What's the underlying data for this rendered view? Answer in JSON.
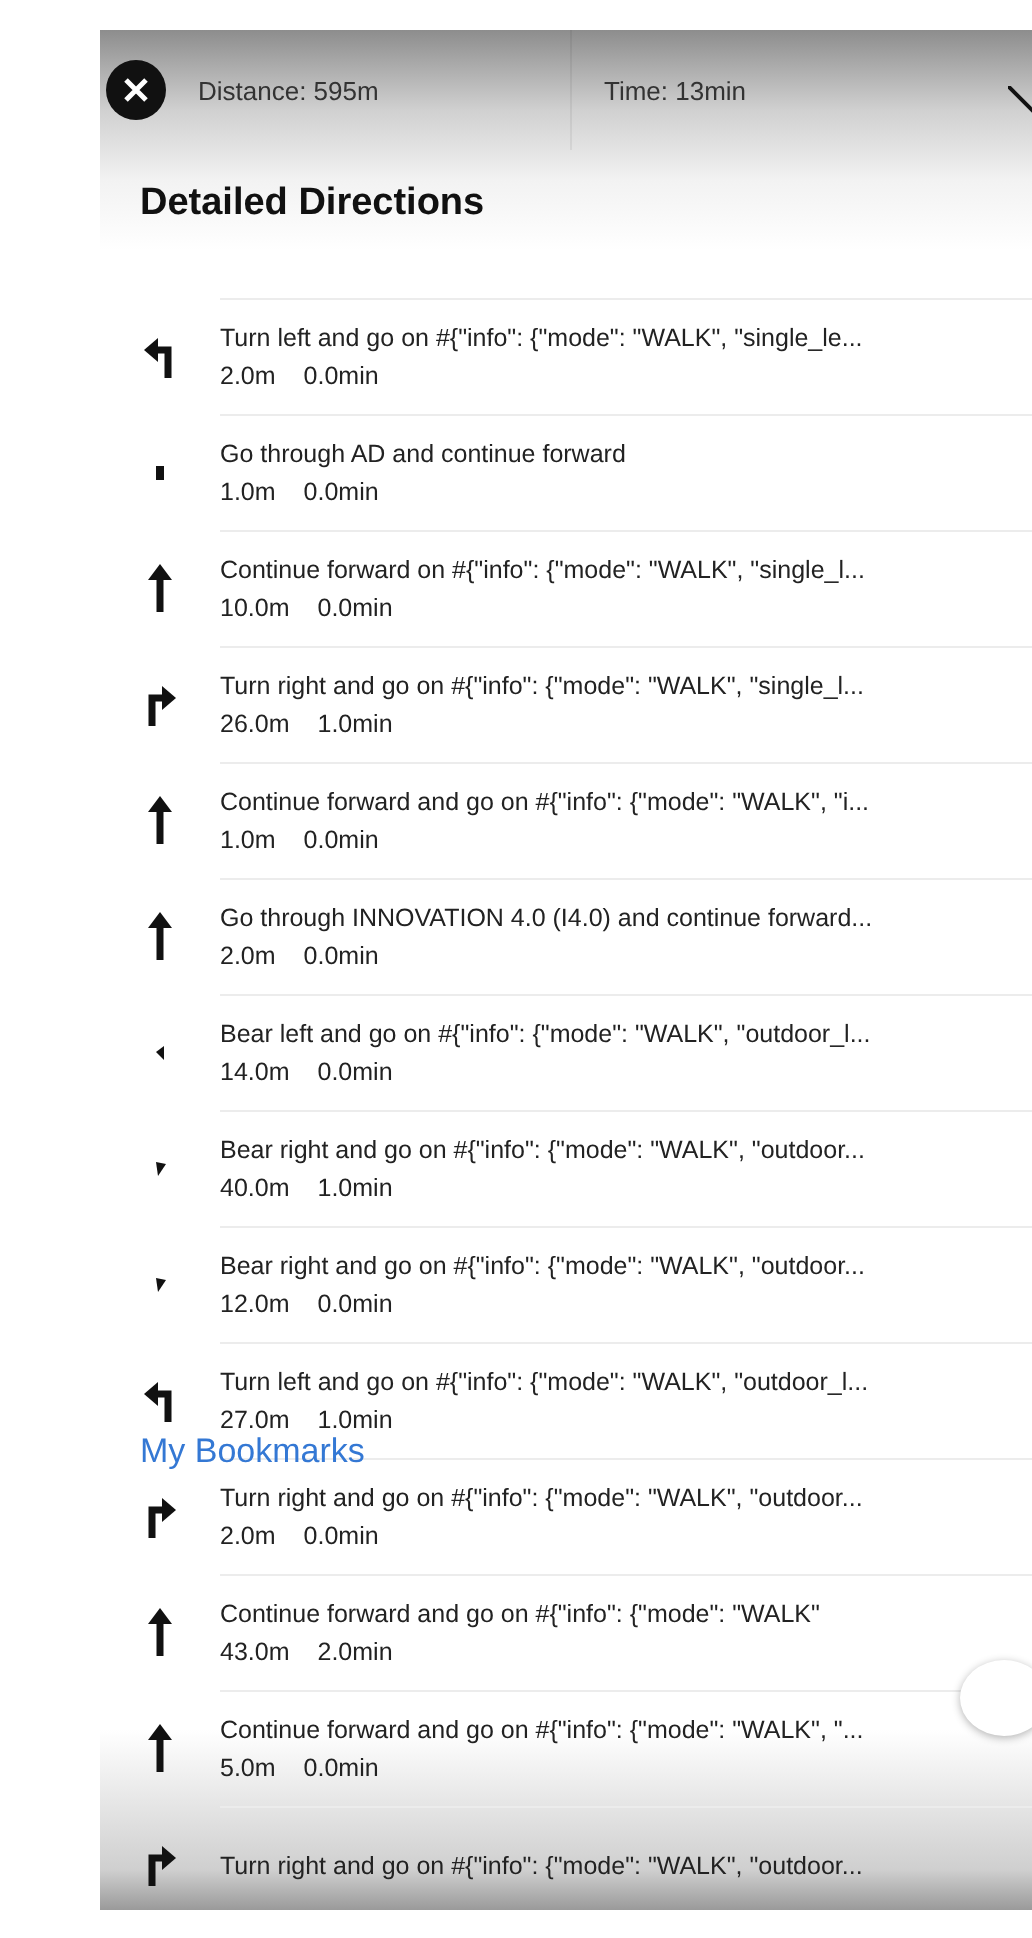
{
  "header": {
    "distance": "Distance: 595m",
    "time": "Time: 13min"
  },
  "title": "Detailed Directions",
  "steps": [
    {
      "kind": "turn-left",
      "text": "Turn left and go on #{\"info\": {\"mode\": \"WALK\", \"single_le...",
      "distance": "2.0m",
      "duration": "0.0min"
    },
    {
      "kind": "dot",
      "text": "Go through AD and continue forward",
      "distance": "1.0m",
      "duration": "0.0min"
    },
    {
      "kind": "straight",
      "text": "Continue forward on #{\"info\": {\"mode\": \"WALK\", \"single_l...",
      "distance": "10.0m",
      "duration": "0.0min"
    },
    {
      "kind": "turn-right",
      "text": "Turn right and go on #{\"info\": {\"mode\": \"WALK\", \"single_l...",
      "distance": "26.0m",
      "duration": "1.0min"
    },
    {
      "kind": "straight",
      "text": "Continue forward and go on #{\"info\": {\"mode\": \"WALK\", \"i...",
      "distance": "1.0m",
      "duration": "0.0min"
    },
    {
      "kind": "straight",
      "text": "Go through INNOVATION 4.0 (I4.0) and continue forward...",
      "distance": "2.0m",
      "duration": "0.0min"
    },
    {
      "kind": "bear-left",
      "text": "Bear left and go on #{\"info\": {\"mode\": \"WALK\", \"outdoor_l...",
      "distance": "14.0m",
      "duration": "0.0min"
    },
    {
      "kind": "bear-right",
      "text": "Bear right and go on #{\"info\": {\"mode\": \"WALK\", \"outdoor...",
      "distance": "40.0m",
      "duration": "1.0min"
    },
    {
      "kind": "bear-right",
      "text": "Bear right and go on #{\"info\": {\"mode\": \"WALK\", \"outdoor...",
      "distance": "12.0m",
      "duration": "0.0min"
    },
    {
      "kind": "turn-left",
      "text": "Turn left and go on #{\"info\": {\"mode\": \"WALK\", \"outdoor_l...",
      "distance": "27.0m",
      "duration": "1.0min"
    },
    {
      "kind": "turn-right",
      "text": "Turn right and go on #{\"info\": {\"mode\": \"WALK\", \"outdoor...",
      "distance": "2.0m",
      "duration": "0.0min"
    },
    {
      "kind": "straight",
      "text": "Continue forward and go on #{\"info\": {\"mode\": \"WALK\"",
      "distance": "43.0m",
      "duration": "2.0min"
    },
    {
      "kind": "straight",
      "text": "Continue forward and go on #{\"info\": {\"mode\": \"WALK\", \"...",
      "distance": "5.0m",
      "duration": "0.0min"
    },
    {
      "kind": "turn-right",
      "text": "Turn right and go on #{\"info\": {\"mode\": \"WALK\", \"outdoor..."
    }
  ],
  "overlay_link": "My Bookmarks"
}
